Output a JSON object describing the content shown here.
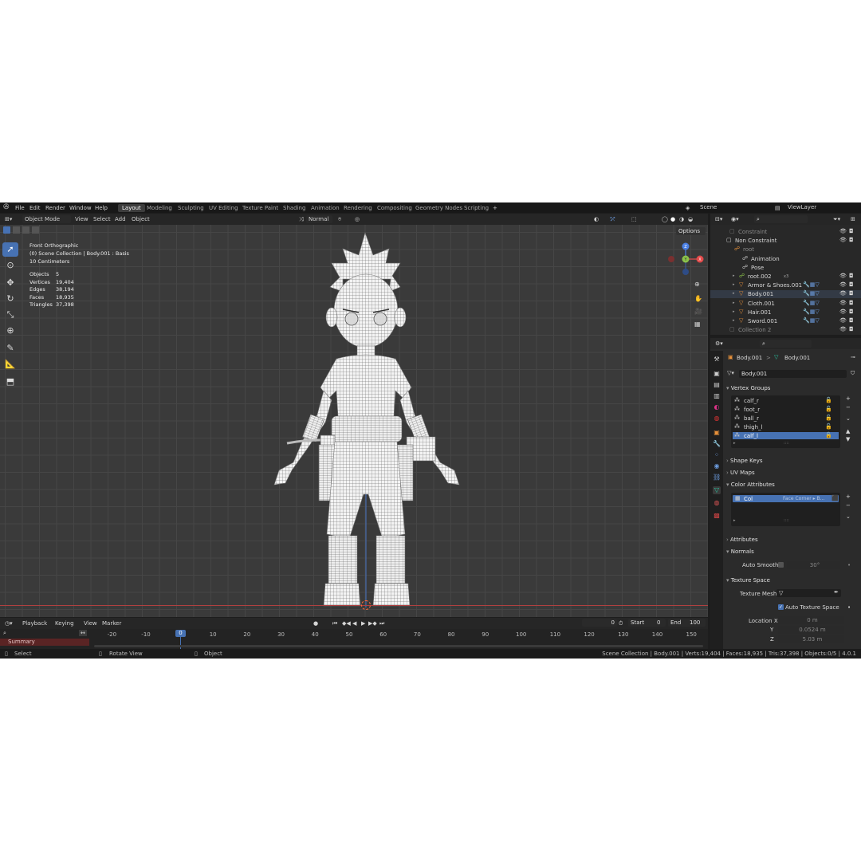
{
  "menu": {
    "items": [
      "File",
      "Edit",
      "Render",
      "Window",
      "Help"
    ],
    "workspaces": [
      "Layout",
      "Modeling",
      "Sculpting",
      "UV Editing",
      "Texture Paint",
      "Shading",
      "Animation",
      "Rendering",
      "Compositing",
      "Geometry Nodes",
      "Scripting"
    ],
    "active_workspace": "Layout",
    "add_tab": "+",
    "scene": "Scene",
    "view_layer": "ViewLayer"
  },
  "viewport_header": {
    "mode": "Object Mode",
    "menus": [
      "View",
      "Select",
      "Add",
      "Object"
    ],
    "orientation": "Normal",
    "options": "Options"
  },
  "viewport_overlay": {
    "view_name": "Front Orthographic",
    "collection_line": "(0) Scene Collection | Body.001 : Basis",
    "scale": "10 Centimeters",
    "stats": [
      {
        "label": "Objects",
        "value": "5"
      },
      {
        "label": "Vertices",
        "value": "19,404"
      },
      {
        "label": "Edges",
        "value": "38,194"
      },
      {
        "label": "Faces",
        "value": "18,935"
      },
      {
        "label": "Triangles",
        "value": "37,398"
      }
    ]
  },
  "gizmo": {
    "x": "X",
    "y": "Y",
    "z": "Z"
  },
  "outliner": {
    "search_placeholder": "",
    "rows": [
      {
        "label": "Constraint",
        "dim": true
      },
      {
        "label": "Non Constraint",
        "dim": false
      },
      {
        "label": "root",
        "dim": true
      },
      {
        "label": "Animation",
        "dim": false
      },
      {
        "label": "Pose",
        "dim": false
      },
      {
        "label": "root.002",
        "dim": false
      },
      {
        "label": "Armor & Shoes.001",
        "dim": false
      },
      {
        "label": "Body.001",
        "dim": false
      },
      {
        "label": "Cloth.001",
        "dim": false
      },
      {
        "label": "Hair.001",
        "dim": false
      },
      {
        "label": "Sword.001",
        "dim": false
      },
      {
        "label": "Collection 2",
        "dim": true
      }
    ],
    "badge": "x3"
  },
  "properties": {
    "breadcrumb_object": "Body.001",
    "breadcrumb_sep": ">",
    "breadcrumb_mesh": "Body.001",
    "mesh_name": "Body.001",
    "panels": {
      "vertex_groups": "Vertex Groups",
      "shape_keys": "Shape Keys",
      "uv_maps": "UV Maps",
      "color_attributes": "Color Attributes",
      "attributes": "Attributes",
      "normals": "Normals",
      "texture_space": "Texture Space"
    },
    "vertex_groups": [
      "calf_r",
      "foot_r",
      "ball_r",
      "thigh_l",
      "calf_l"
    ],
    "active_vertex_group": "calf_l",
    "color_attribute": {
      "name": "Col",
      "domain": "Face Corner ▸ B..."
    },
    "auto_smooth_label": "Auto Smooth",
    "auto_smooth_value": "30°",
    "texture_mesh_label": "Texture Mesh",
    "auto_texture_space_label": "Auto Texture Space",
    "location_label": "Location X",
    "loc_x": "0 m",
    "loc_y_label": "Y",
    "loc_y": "0.0524 m",
    "loc_z_label": "Z",
    "loc_z": "5.03 m"
  },
  "timeline": {
    "menus": [
      "Playback",
      "Keying",
      "View",
      "Marker"
    ],
    "current_frame": "0",
    "start_label": "Start",
    "start": "0",
    "end_label": "End",
    "end": "100",
    "ruler": [
      "-20",
      "-10",
      "0",
      "10",
      "20",
      "30",
      "40",
      "50",
      "60",
      "70",
      "80",
      "90",
      "100",
      "110",
      "120",
      "130",
      "140",
      "150"
    ],
    "summary": "Summary"
  },
  "statusbar": {
    "select": "Select",
    "rotate": "Rotate View",
    "object": "Object",
    "info": "Scene Collection | Body.001 | Verts:19,404 | Faces:18,935 | Tris:37,398 | Objects:0/5 | 4.0.1"
  },
  "colors": {
    "accent": "#4772b3",
    "x_axis": "#e34a4a",
    "y_axis": "#8bc34a",
    "z_axis": "#4a7fe3",
    "mesh_icon": "#27c9a3",
    "object_icon": "#e8913a"
  }
}
